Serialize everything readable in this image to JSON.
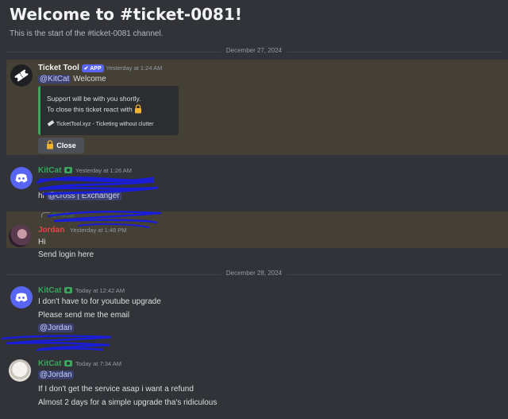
{
  "channel": {
    "welcome_title": "Welcome to #ticket-0081!",
    "welcome_sub": "This is the start of the #ticket-0081 channel."
  },
  "dividers": [
    "December 27, 2024",
    "December 28, 2024"
  ],
  "colors": {
    "bg": "#313338",
    "highlight": "#444035",
    "mention_bg": "#3c4270",
    "green_name": "#3ba55d",
    "red_name": "#ed4245",
    "blurple": "#5865f2"
  },
  "messages": {
    "ticket": {
      "author": "Ticket Tool",
      "badge": "APP",
      "time": "Yesterday at 1:24 AM",
      "mention": "@KitCat",
      "text": "Welcome",
      "embed_line1": "Support will be with you shortly.",
      "embed_line2": "To close this ticket react with",
      "embed_footer": "TicketTool.xyz - Ticketing without clutter",
      "button": "Close",
      "icon": "ticket-icon"
    },
    "kit1": {
      "author": "KitCat",
      "time": "Yesterday at 1:26 AM",
      "line1_prefix": "hi",
      "mention": "@cross | Exchanger"
    },
    "jordan": {
      "author": "Jordan",
      "time": "Yesterday at 1:48 PM",
      "reply_mention": "@KitCat",
      "line1": "Hi",
      "line2": "Send login here"
    },
    "kit2": {
      "author": "KitCat",
      "time": "Today at 12:42 AM",
      "line1": "I don't have to for youtube upgrade",
      "line2": "Please send me the email",
      "mention": "@Jordan"
    },
    "kit3": {
      "author": "KitCat",
      "time": "Today at 7:34 AM",
      "mention": "@Jordan",
      "line1": "If I don't get the service asap i want a refund",
      "line2": "Almost 2 days for a simple upgrade tha's ridiculous"
    }
  }
}
